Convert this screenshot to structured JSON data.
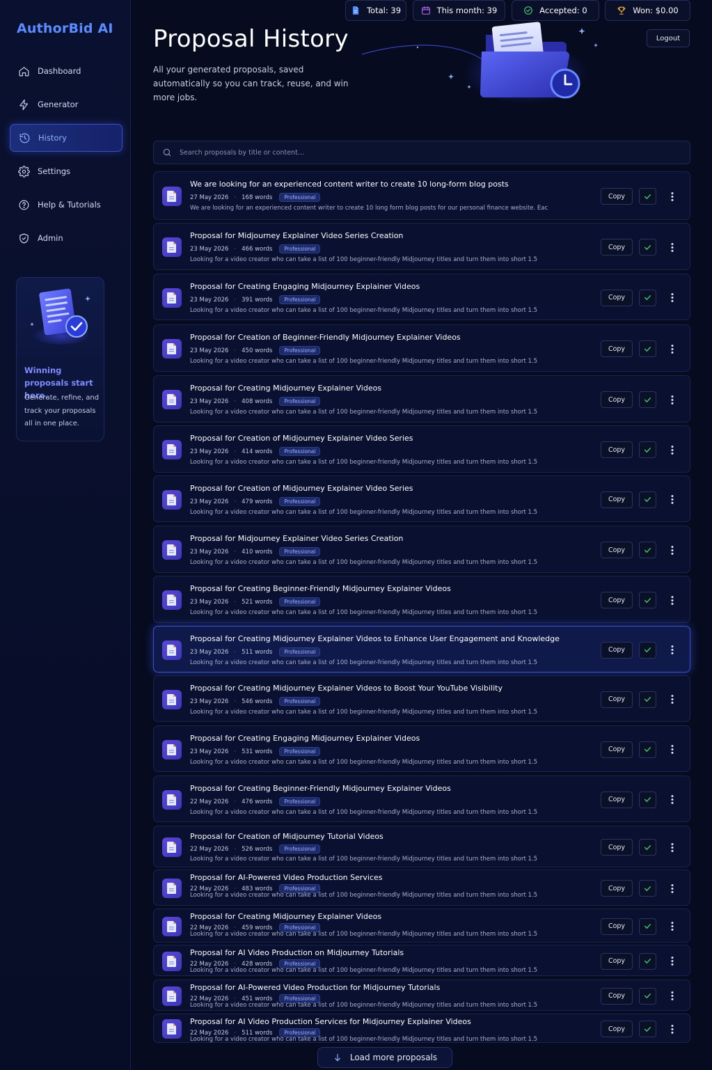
{
  "app": {
    "brand": "AuthorBid AI"
  },
  "sidebar": {
    "items": [
      {
        "label": "Dashboard",
        "icon": "home-icon",
        "active": false
      },
      {
        "label": "Generator",
        "icon": "lightning-icon",
        "active": false
      },
      {
        "label": "History",
        "icon": "history-icon",
        "active": true
      },
      {
        "label": "Settings",
        "icon": "gear-icon",
        "active": false
      },
      {
        "label": "Help & Tutorials",
        "icon": "help-icon",
        "active": false
      },
      {
        "label": "Admin",
        "icon": "shield-icon",
        "active": false
      }
    ],
    "promo": {
      "title": "Winning proposals start here.",
      "text": "Generate, refine, and track your proposals all in one place."
    }
  },
  "header": {
    "title": "Proposal History",
    "subtitle": "All your generated proposals, saved automatically so you can track, reuse, and win more jobs.",
    "logout_label": "Logout"
  },
  "stats": {
    "total": "Total: 39",
    "this_month": "This month: 39",
    "accepted": "Accepted: 0",
    "won": "Won: $0.00"
  },
  "search": {
    "placeholder": "Search proposals by title or content..."
  },
  "row_actions": {
    "copy_label": "Copy"
  },
  "proposals": [
    {
      "title": "We are looking for an experienced content writer to create 10 long-form blog posts",
      "date": "27 May 2026",
      "words": "168 words",
      "tone": "Professional",
      "excerpt": "We are looking for an experienced content writer to create 10 long form blog posts for our personal finance website. Eac"
    },
    {
      "title": "Proposal for Midjourney Explainer Video Series Creation",
      "date": "23 May 2026",
      "words": "466 words",
      "tone": "Professional",
      "excerpt": "Looking for a video creator who can take a list of 100 beginner-friendly Midjourney titles and turn them into short 1.5"
    },
    {
      "title": "Proposal for Creating Engaging Midjourney Explainer Videos",
      "date": "23 May 2026",
      "words": "391 words",
      "tone": "Professional",
      "excerpt": "Looking for a video creator who can take a list of 100 beginner-friendly Midjourney titles and turn them into short 1.5"
    },
    {
      "title": "Proposal for Creation of Beginner-Friendly Midjourney Explainer Videos",
      "date": "23 May 2026",
      "words": "450 words",
      "tone": "Professional",
      "excerpt": "Looking for a video creator who can take a list of 100 beginner-friendly Midjourney titles and turn them into short 1.5"
    },
    {
      "title": "Proposal for Creating Midjourney Explainer Videos",
      "date": "23 May 2026",
      "words": "408 words",
      "tone": "Professional",
      "excerpt": "Looking for a video creator who can take a list of 100 beginner-friendly Midjourney titles and turn them into short 1.5"
    },
    {
      "title": "Proposal for Creation of Midjourney Explainer Video Series",
      "date": "23 May 2026",
      "words": "414 words",
      "tone": "Professional",
      "excerpt": "Looking for a video creator who can take a list of 100 beginner-friendly Midjourney titles and turn them into short 1.5"
    },
    {
      "title": "Proposal for Creation of Midjourney Explainer Video Series",
      "date": "23 May 2026",
      "words": "479 words",
      "tone": "Professional",
      "excerpt": "Looking for a video creator who can take a list of 100 beginner-friendly Midjourney titles and turn them into short 1.5"
    },
    {
      "title": "Proposal for Midjourney Explainer Video Series Creation",
      "date": "23 May 2026",
      "words": "410 words",
      "tone": "Professional",
      "excerpt": "Looking for a video creator who can take a list of 100 beginner-friendly Midjourney titles and turn them into short 1.5"
    },
    {
      "title": "Proposal for Creating Beginner-Friendly Midjourney Explainer Videos",
      "date": "23 May 2026",
      "words": "521 words",
      "tone": "Professional",
      "excerpt": "Looking for a video creator who can take a list of 100 beginner-friendly Midjourney titles and turn them into short 1.5"
    },
    {
      "title": "Proposal for Creating Midjourney Explainer Videos to Enhance User Engagement and Knowledge",
      "date": "23 May 2026",
      "words": "511 words",
      "tone": "Professional",
      "excerpt": "Looking for a video creator who can take a list of 100 beginner-friendly Midjourney titles and turn them into short 1.5",
      "highlighted": true
    },
    {
      "title": "Proposal for Creating Midjourney Explainer Videos to Boost Your YouTube Visibility",
      "date": "23 May 2026",
      "words": "546 words",
      "tone": "Professional",
      "excerpt": "Looking for a video creator who can take a list of 100 beginner-friendly Midjourney titles and turn them into short 1.5"
    },
    {
      "title": "Proposal for Creating Engaging Midjourney Explainer Videos",
      "date": "23 May 2026",
      "words": "531 words",
      "tone": "Professional",
      "excerpt": "Looking for a video creator who can take a list of 100 beginner-friendly Midjourney titles and turn them into short 1.5"
    },
    {
      "title": "Proposal for Creating Beginner-Friendly Midjourney Explainer Videos",
      "date": "22 May 2026",
      "words": "476 words",
      "tone": "Professional",
      "excerpt": "Looking for a video creator who can take a list of 100 beginner-friendly Midjourney titles and turn them into short 1.5"
    },
    {
      "title": "Proposal for Creation of Midjourney Tutorial Videos",
      "date": "22 May 2026",
      "words": "526 words",
      "tone": "Professional",
      "excerpt": "Looking for a video creator who can take a list of 100 beginner-friendly Midjourney titles and turn them into short 1.5"
    },
    {
      "title": "Proposal for AI-Powered Video Production Services",
      "date": "22 May 2026",
      "words": "483 words",
      "tone": "Professional",
      "excerpt": "Looking for a video creator who can take a list of 100 beginner-friendly Midjourney titles and turn them into short 1.5"
    },
    {
      "title": "Proposal for Creating Midjourney Explainer Videos",
      "date": "22 May 2026",
      "words": "459 words",
      "tone": "Professional",
      "excerpt": "Looking for a video creator who can take a list of 100 beginner-friendly Midjourney titles and turn them into short 1.5"
    },
    {
      "title": "Proposal for AI Video Production on Midjourney Tutorials",
      "date": "22 May 2026",
      "words": "428 words",
      "tone": "Professional",
      "excerpt": "Looking for a video creator who can take a list of 100 beginner-friendly Midjourney titles and turn them into short 1.5"
    },
    {
      "title": "Proposal for AI-Powered Video Production for Midjourney Tutorials",
      "date": "22 May 2026",
      "words": "451 words",
      "tone": "Professional",
      "excerpt": "Looking for a video creator who can take a list of 100 beginner-friendly Midjourney titles and turn them into short 1.5"
    },
    {
      "title": "Proposal for AI Video Production Services for Midjourney Explainer Videos",
      "date": "22 May 2026",
      "words": "511 words",
      "tone": "Professional",
      "excerpt": "Looking for a video creator who can take a list of 100 beginner-friendly Midjourney titles and turn them into short 1.5"
    }
  ],
  "load_more_label": "Load more proposals",
  "colors": {
    "accent": "#5b8cff",
    "check": "#3ecf6a",
    "background": "#060b1f"
  }
}
